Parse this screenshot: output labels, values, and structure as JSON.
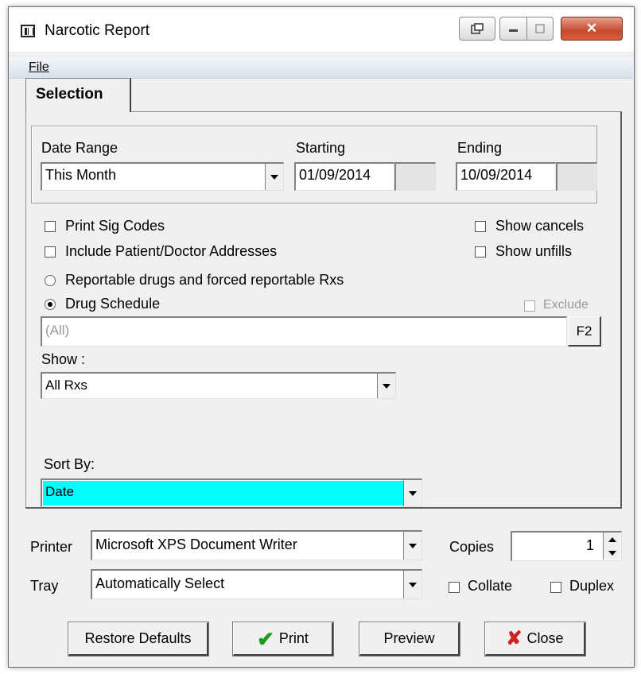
{
  "window": {
    "title": "Narcotic Report"
  },
  "menu": {
    "file_label": "File"
  },
  "tab": {
    "selection_label": "Selection"
  },
  "date_range": {
    "label": "Date Range",
    "value": "This Month",
    "starting_label": "Starting",
    "starting_value": "01/09/2014",
    "ending_label": "Ending",
    "ending_value": "10/09/2014"
  },
  "options": {
    "print_sig_codes": {
      "label": "Print Sig Codes",
      "checked": false
    },
    "include_addresses": {
      "label": "Include Patient/Doctor Addresses",
      "checked": false
    },
    "show_cancels": {
      "label": "Show cancels",
      "checked": false
    },
    "show_unfills": {
      "label": "Show unfills",
      "checked": false
    },
    "reportable_radio": {
      "label": "Reportable drugs and forced reportable Rxs",
      "selected": false
    },
    "drug_schedule_radio": {
      "label": "Drug Schedule",
      "selected": true
    },
    "exclude": {
      "label": "Exclude",
      "checked": false,
      "enabled": false
    }
  },
  "schedule_field": {
    "value": "(All)",
    "lookup_label": "F2"
  },
  "show": {
    "label": "Show :",
    "value": "All Rxs"
  },
  "sort_by": {
    "label": "Sort By:",
    "value": "Date"
  },
  "printer": {
    "printer_label": "Printer",
    "printer_value": "Microsoft XPS Document Writer",
    "tray_label": "Tray",
    "tray_value": "Automatically Select",
    "copies_label": "Copies",
    "copies_value": "1",
    "collate_label": "Collate",
    "duplex_label": "Duplex"
  },
  "buttons": {
    "restore_defaults": "Restore Defaults",
    "print": "Print",
    "preview": "Preview",
    "close": "Close"
  },
  "colors": {
    "highlight": "#00ffff",
    "check": "#1c9a1c",
    "close_x": "#d21f1f"
  }
}
